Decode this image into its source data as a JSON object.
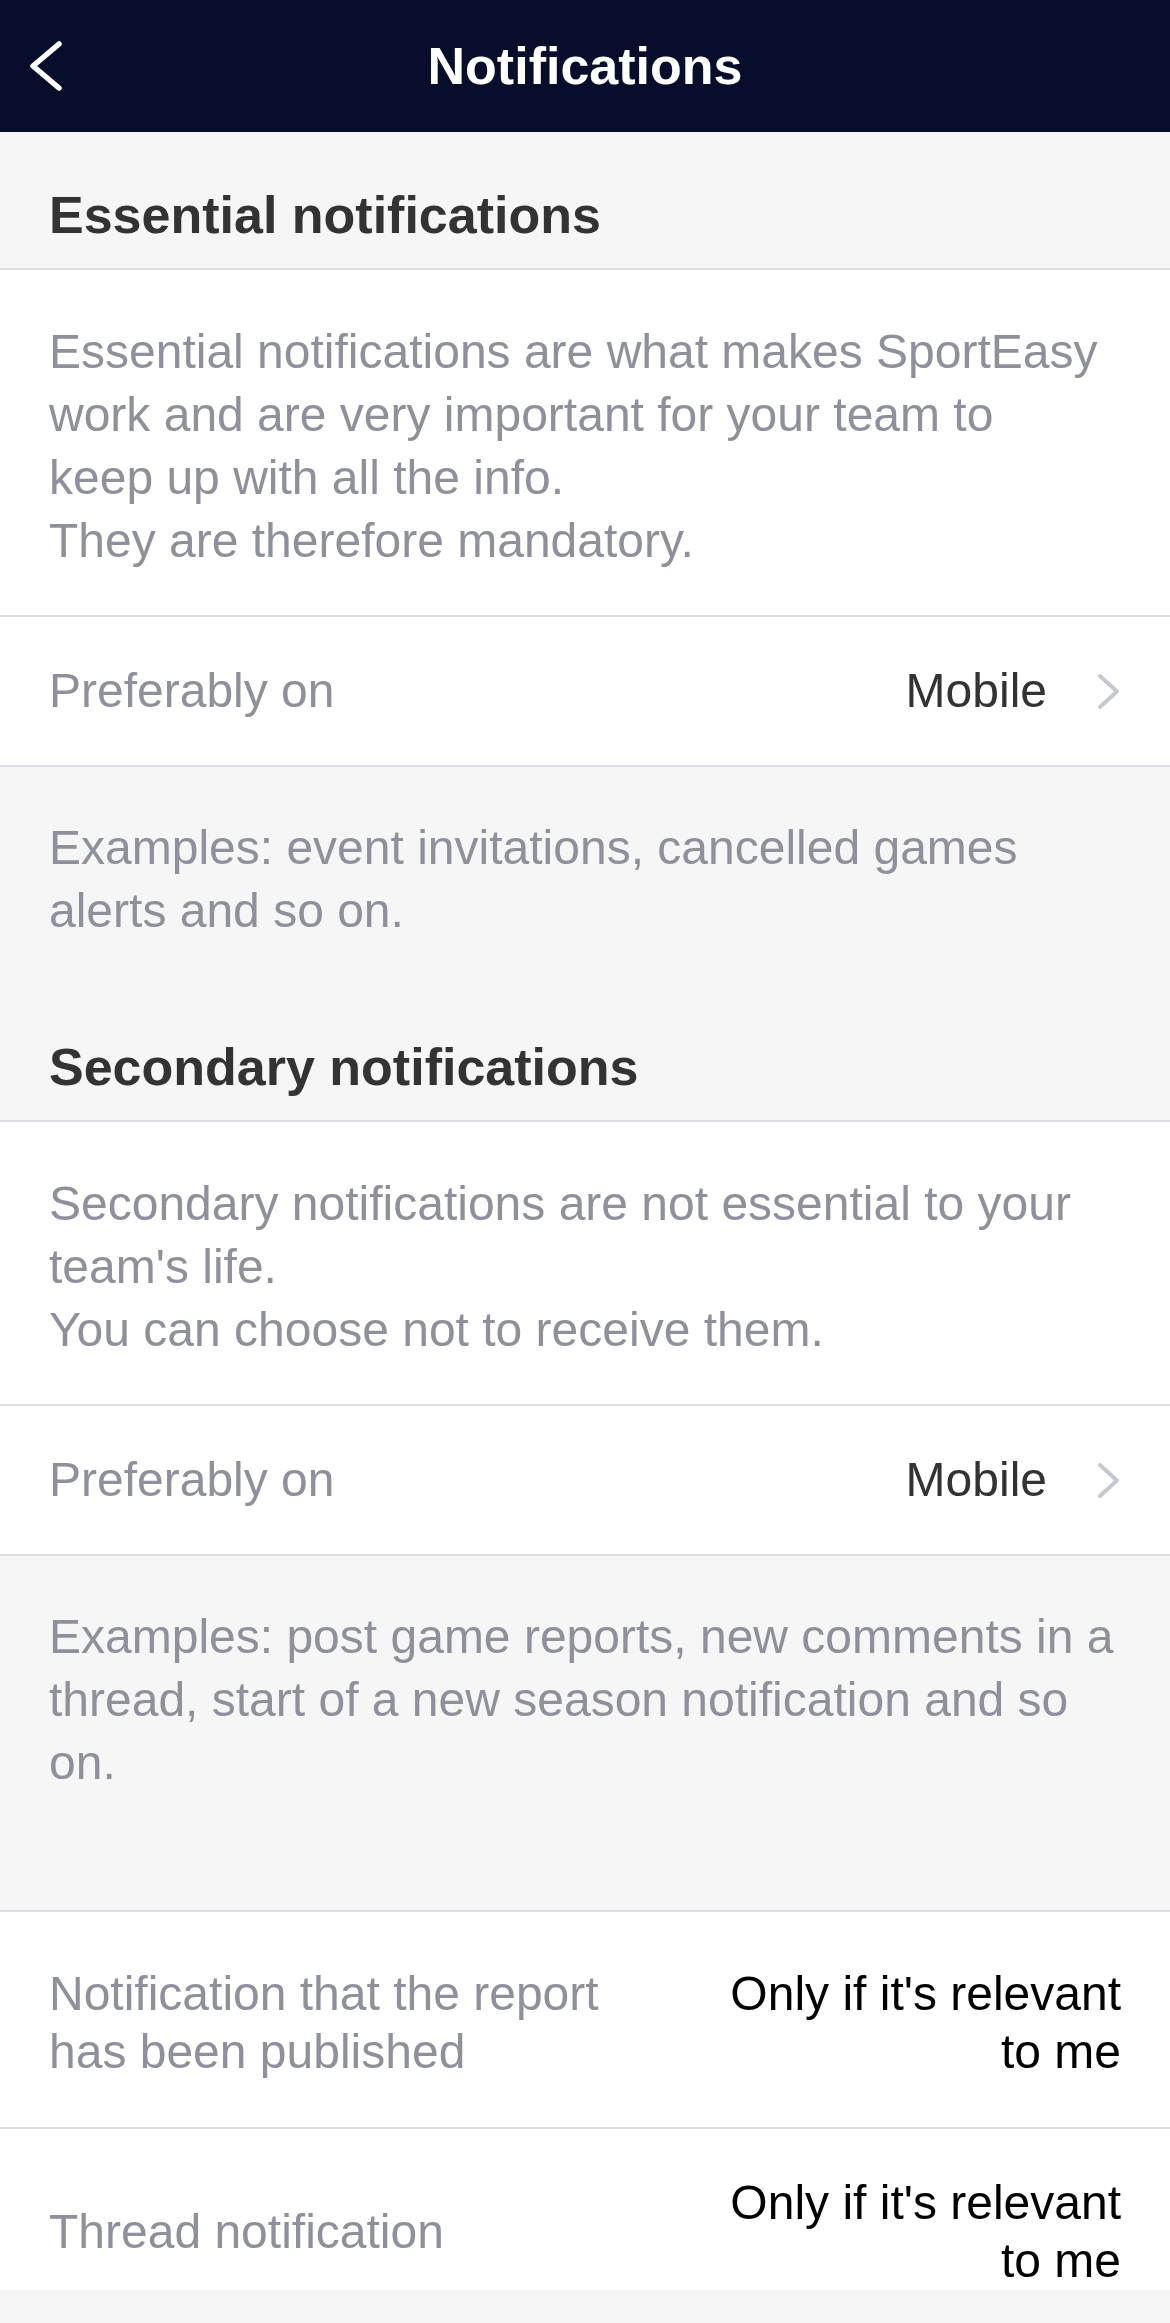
{
  "header": {
    "title": "Notifications"
  },
  "sections": [
    {
      "title": "Essential notifications",
      "description": "Essential notifications are what makes SportEasy work and are very important for your team to keep up with all the info.\nThey are therefore mandatory.",
      "preference": {
        "label": "Preferably on",
        "value": "Mobile"
      },
      "examples": "Examples: event invitations, cancelled games alerts and so on."
    },
    {
      "title": "Secondary notifications",
      "description": "Secondary notifications are not essential to your team's life.\nYou can choose not to receive them.",
      "preference": {
        "label": "Preferably on",
        "value": "Mobile"
      },
      "examples": "Examples: post game reports, new comments in a thread, start of a new season notification and so on."
    }
  ],
  "settings": [
    {
      "label": "Notification that the report has been published",
      "value": "Only if it's relevant to me"
    },
    {
      "label": "Thread notification",
      "value": "Only if it's relevant to me"
    }
  ]
}
